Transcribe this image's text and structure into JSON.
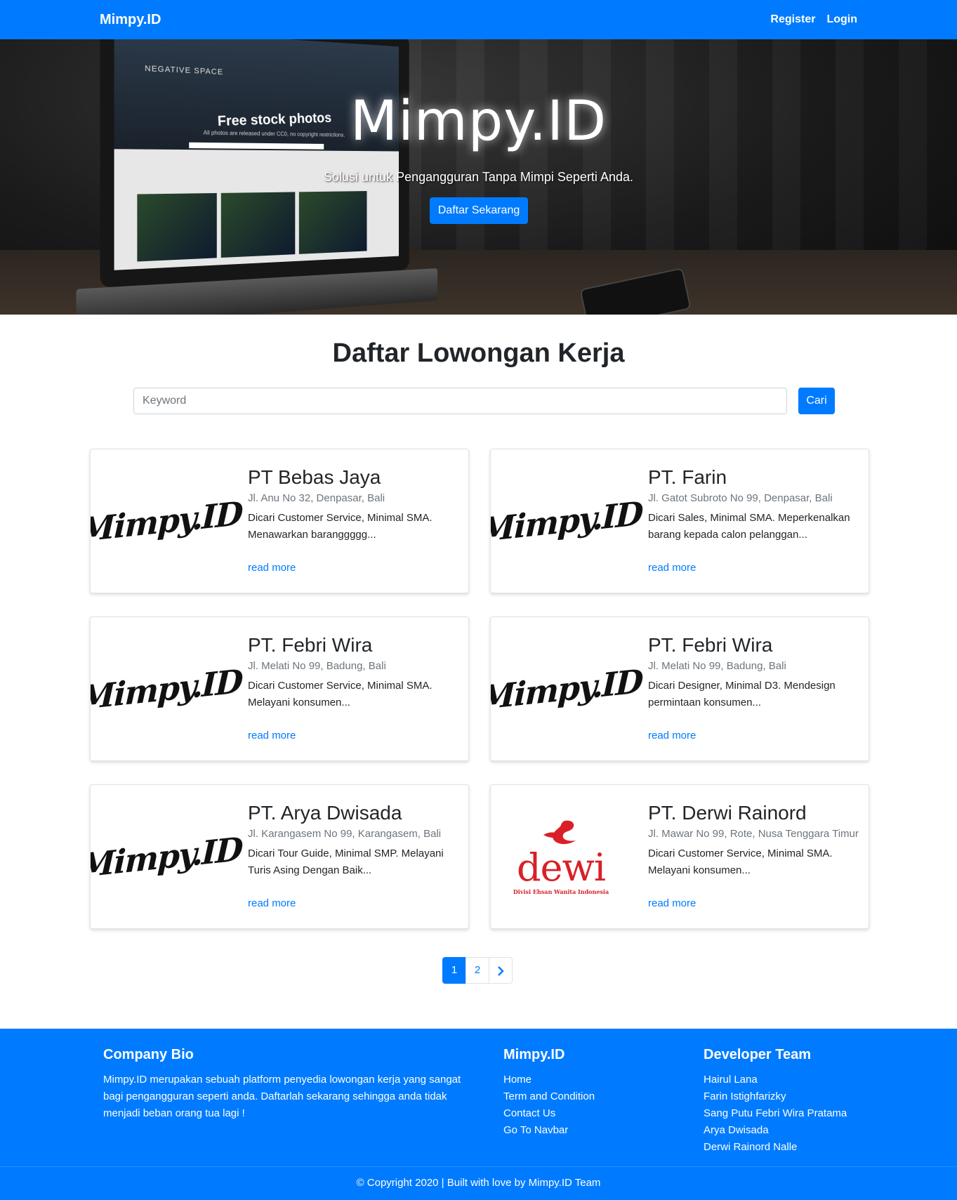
{
  "navbar": {
    "brand": "Mimpy.ID",
    "links": [
      "Register",
      "Login"
    ]
  },
  "hero": {
    "title": "Mimpy.ID",
    "subtitle": "Solusi untuk Pengangguran Tanpa Mimpi Seperti Anda.",
    "cta_label": "Daftar Sekarang",
    "image_text": {
      "heading": "Free stock photos",
      "tagline": "All photos are released under CC0, no copyright restrictions.",
      "brand": "NEGATIVE SPACE"
    }
  },
  "main": {
    "title": "Daftar Lowongan Kerja",
    "search": {
      "placeholder": "Keyword",
      "value": "",
      "button": "Cari"
    }
  },
  "jobs": [
    {
      "company": "PT Bebas Jaya",
      "address": "Jl. Anu No 32, Denpasar, Bali",
      "description": "Dicari Customer Service, Minimal SMA. Menawarkan baranggggg...",
      "link": "read more",
      "logo": "Mimpy.ID"
    },
    {
      "company": "PT. Farin",
      "address": "Jl. Gatot Subroto No 99, Denpasar, Bali",
      "description": "Dicari Sales, Minimal SMA. Meperkenalkan barang kepada calon pelanggan...",
      "link": "read more",
      "logo": "Mimpy.ID"
    },
    {
      "company": "PT. Febri Wira",
      "address": "Jl. Melati No 99, Badung, Bali",
      "description": "Dicari Customer Service, Minimal SMA. Melayani konsumen...",
      "link": "read more",
      "logo": "Mimpy.ID"
    },
    {
      "company": "PT. Febri Wira",
      "address": "Jl. Melati No 99, Badung, Bali",
      "description": "Dicari Designer, Minimal D3. Mendesign permintaan konsumen...",
      "link": "read more",
      "logo": "Mimpy.ID"
    },
    {
      "company": "PT. Arya Dwisada",
      "address": "Jl. Karangasem No 99, Karangasem, Bali",
      "description": "Dicari Tour Guide, Minimal SMP. Melayani Turis Asing Dengan Baik...",
      "link": "read more",
      "logo": "Mimpy.ID"
    },
    {
      "company": "PT. Derwi Rainord",
      "address": "Jl. Mawar No 99, Rote, Nusa Tenggara Timur",
      "description": "Dicari Customer Service, Minimal SMA. Melayani konsumen...",
      "link": "read more",
      "logo": "dewi",
      "logo_tagline": "Divisi Ehsan Wanita Indonesia"
    }
  ],
  "pagination": {
    "pages": [
      "1",
      "2"
    ],
    "current": "1",
    "next_icon": "chevron-right-icon"
  },
  "footer": {
    "bio_title": "Company Bio",
    "bio_text": "Mimpy.ID merupakan sebuah platform penyedia lowongan kerja yang sangat bagi pengangguran seperti anda. Daftarlah sekarang sehingga anda tidak menjadi beban orang tua lagi !",
    "site_title": "Mimpy.ID",
    "site_links": [
      "Home",
      "Term and Condition",
      "Contact Us",
      "Go To Navbar"
    ],
    "team_title": "Developer Team",
    "team": [
      "Hairul Lana",
      "Farin Istighfarizky",
      "Sang Putu Febri Wira Pratama",
      "Arya Dwisada",
      "Derwi Rainord Nalle"
    ],
    "copyright": "© Copyright 2020 | Built with love by Mimpy.ID Team"
  },
  "colors": {
    "primary": "#007bff",
    "text": "#212529",
    "muted": "#6c757d",
    "dewi_red": "#d92027"
  }
}
